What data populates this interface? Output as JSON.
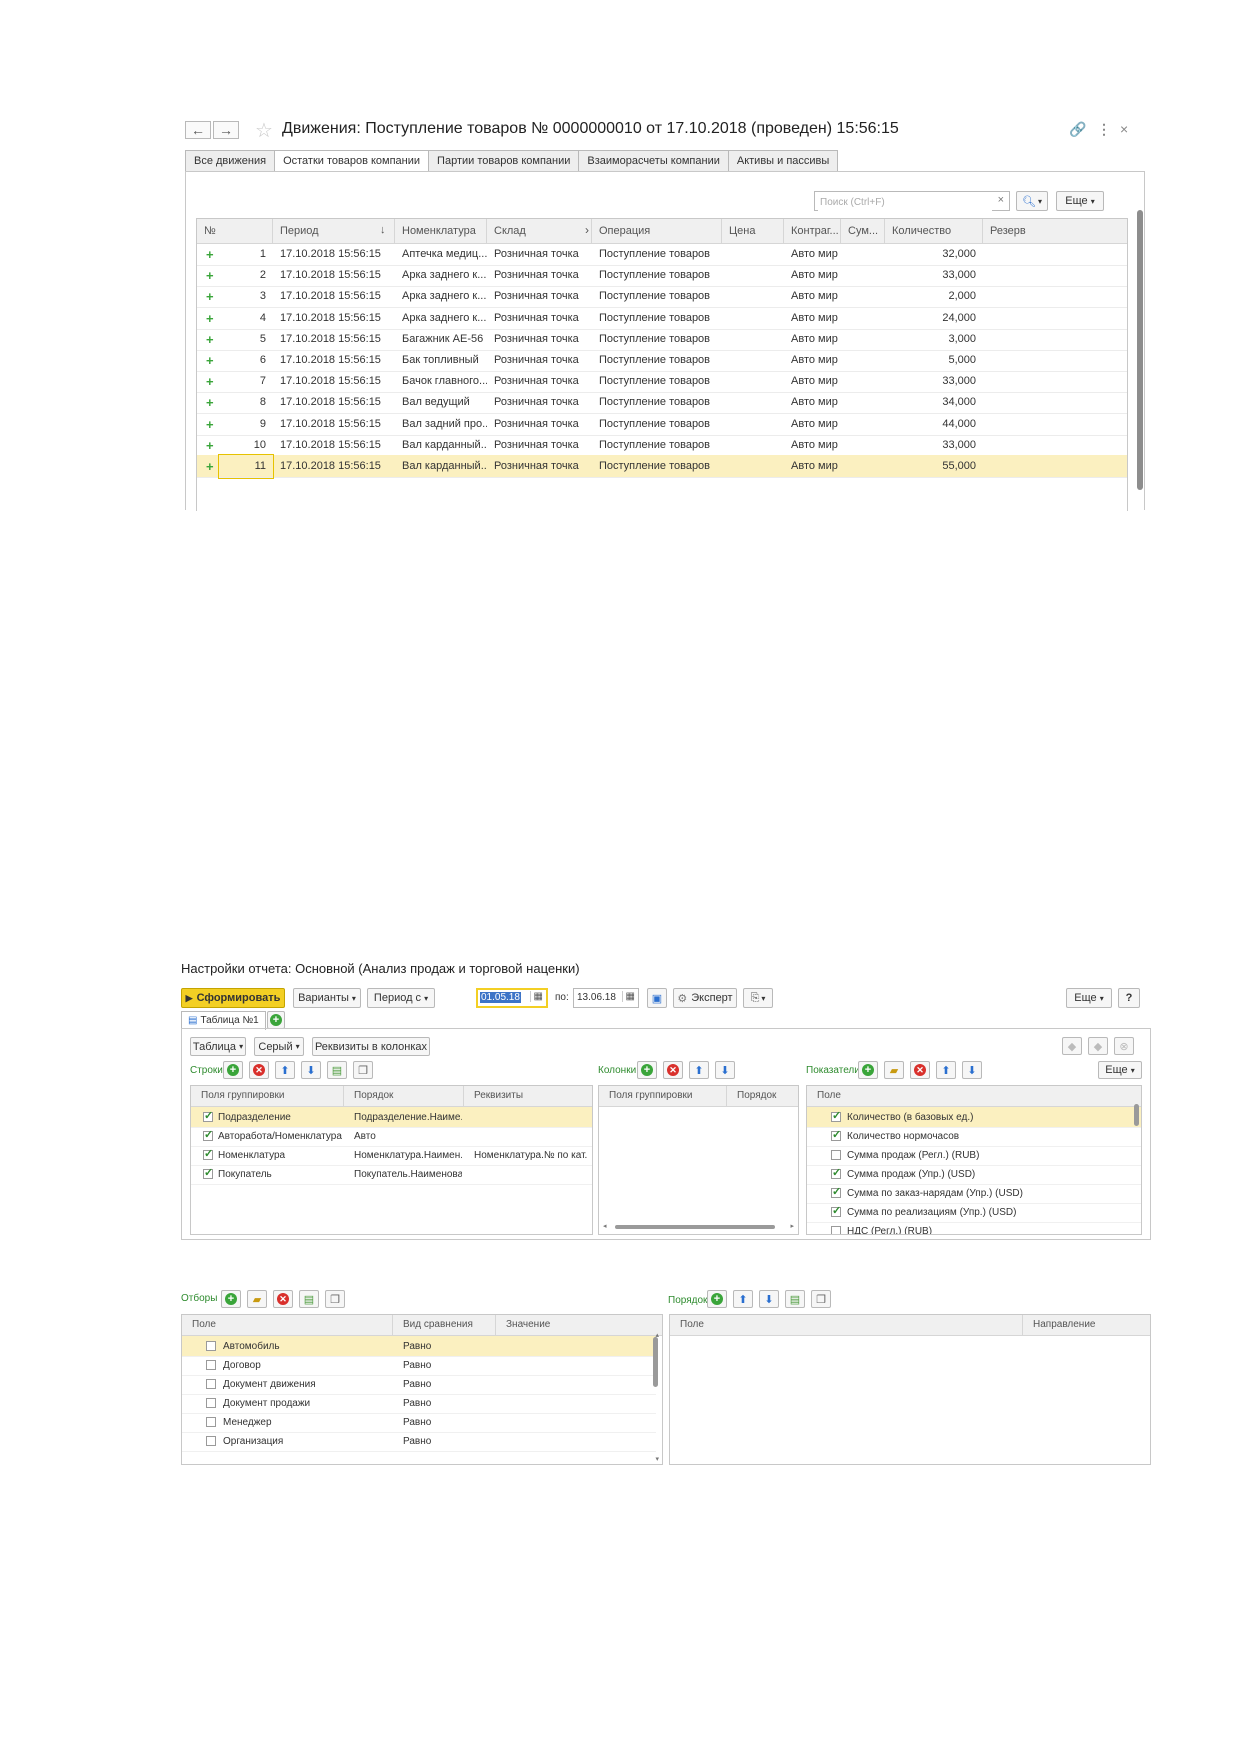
{
  "doc_window": {
    "title": "Движения: Поступление товаров № 0000000010  от 17.10.2018 (проведен) 15:56:15",
    "tabs": [
      "Все движения",
      "Остатки товаров компании",
      "Партии товаров компании",
      "Взаиморасчеты компании",
      "Активы и пассивы"
    ],
    "active_tab": 1,
    "search_placeholder": "Поиск (Ctrl+F)",
    "more_label": "Еще",
    "columns": [
      "№",
      "Период",
      "Номенклатура",
      "Склад",
      "Операция",
      "Цена",
      "Контраг...",
      "Сум...",
      "Количество",
      "Резерв"
    ],
    "rows": [
      {
        "n": "1",
        "period": "17.10.2018 15:56:15",
        "item": "Аптечка медиц...",
        "warehouse": "Розничная точка",
        "op": "Поступление товаров",
        "partner": "Авто мир",
        "qty": "32,000"
      },
      {
        "n": "2",
        "period": "17.10.2018 15:56:15",
        "item": "Арка заднего к...",
        "warehouse": "Розничная точка",
        "op": "Поступление товаров",
        "partner": "Авто мир",
        "qty": "33,000"
      },
      {
        "n": "3",
        "period": "17.10.2018 15:56:15",
        "item": "Арка заднего к...",
        "warehouse": "Розничная точка",
        "op": "Поступление товаров",
        "partner": "Авто мир",
        "qty": "2,000"
      },
      {
        "n": "4",
        "period": "17.10.2018 15:56:15",
        "item": "Арка заднего к...",
        "warehouse": "Розничная точка",
        "op": "Поступление товаров",
        "partner": "Авто мир",
        "qty": "24,000"
      },
      {
        "n": "5",
        "period": "17.10.2018 15:56:15",
        "item": "Багажник AE-56",
        "warehouse": "Розничная точка",
        "op": "Поступление товаров",
        "partner": "Авто мир",
        "qty": "3,000"
      },
      {
        "n": "6",
        "period": "17.10.2018 15:56:15",
        "item": "Бак топливный",
        "warehouse": "Розничная точка",
        "op": "Поступление товаров",
        "partner": "Авто мир",
        "qty": "5,000"
      },
      {
        "n": "7",
        "period": "17.10.2018 15:56:15",
        "item": "Бачок главного...",
        "warehouse": "Розничная точка",
        "op": "Поступление товаров",
        "partner": "Авто мир",
        "qty": "33,000"
      },
      {
        "n": "8",
        "period": "17.10.2018 15:56:15",
        "item": "Вал ведущий",
        "warehouse": "Розничная точка",
        "op": "Поступление товаров",
        "partner": "Авто мир",
        "qty": "34,000"
      },
      {
        "n": "9",
        "period": "17.10.2018 15:56:15",
        "item": "Вал задний про...",
        "warehouse": "Розничная точка",
        "op": "Поступление товаров",
        "partner": "Авто мир",
        "qty": "44,000"
      },
      {
        "n": "10",
        "period": "17.10.2018 15:56:15",
        "item": "Вал карданный...",
        "warehouse": "Розничная точка",
        "op": "Поступление товаров",
        "partner": "Авто мир",
        "qty": "33,000"
      },
      {
        "n": "11",
        "period": "17.10.2018 15:56:15",
        "item": "Вал карданный...",
        "warehouse": "Розничная точка",
        "op": "Поступление товаров",
        "partner": "Авто мир",
        "qty": "55,000"
      }
    ],
    "selected_row": 10
  },
  "report_settings": {
    "title": "Настройки отчета: Основной (Анализ продаж и торговой наценки)",
    "generate_label": "Сформировать",
    "variants_label": "Варианты",
    "period_label": "Период с",
    "date_from": "01.05.18",
    "to_label": "по:",
    "date_to": "13.06.18",
    "expert_label": "Эксперт",
    "more_label": "Еще",
    "help_label": "?",
    "table_tab": "Таблица №1",
    "table_btn": "Таблица",
    "gray_btn": "Серый",
    "props_btn": "Реквизиты в колонках",
    "rows_label": "Строки",
    "columns_label": "Колонки",
    "indicators_label": "Показатели",
    "rows_table": {
      "headers": [
        "Поля группировки",
        "Порядок",
        "Реквизиты"
      ],
      "items": [
        {
          "field": "Подразделение",
          "order": "Подразделение.Наиме...",
          "props": "",
          "checked": true
        },
        {
          "field": "Авторабота/Номенклатура",
          "order": "Авто",
          "props": "",
          "checked": true
        },
        {
          "field": "Номенклатура",
          "order": "Номенклатура.Наимен...",
          "props": "Номенклатура.№ по кат.",
          "checked": true
        },
        {
          "field": "Покупатель",
          "order": "Покупатель.Наименова...",
          "props": "",
          "checked": true
        }
      ]
    },
    "columns_table": {
      "headers": [
        "Поля группировки",
        "Порядок"
      ]
    },
    "indicators_table": {
      "header": "Поле",
      "items": [
        {
          "label": "Количество (в базовых ед.)",
          "checked": true
        },
        {
          "label": "Количество нормочасов",
          "checked": true
        },
        {
          "label": "Сумма продаж (Регл.) (RUB)",
          "checked": false
        },
        {
          "label": "Сумма продаж (Упр.) (USD)",
          "checked": true
        },
        {
          "label": "Сумма по заказ-нарядам (Упр.) (USD)",
          "checked": true
        },
        {
          "label": "Сумма по реализациям (Упр.) (USD)",
          "checked": true
        },
        {
          "label": "НДС (Регл.) (RUB)",
          "checked": false
        }
      ]
    },
    "filters_label": "Отборы",
    "filters_table": {
      "headers": [
        "Поле",
        "Вид сравнения",
        "Значение"
      ],
      "items": [
        {
          "field": "Автомобиль",
          "cmp": "Равно"
        },
        {
          "field": "Договор",
          "cmp": "Равно"
        },
        {
          "field": "Документ движения",
          "cmp": "Равно"
        },
        {
          "field": "Документ продажи",
          "cmp": "Равно"
        },
        {
          "field": "Менеджер",
          "cmp": "Равно"
        },
        {
          "field": "Организация",
          "cmp": "Равно"
        }
      ]
    },
    "order_label": "Порядок",
    "order_table": {
      "headers": [
        "Поле",
        "Направление"
      ]
    }
  },
  "colors": {
    "accent_yellow": "#f3cf24",
    "selection": "#fbf0c0",
    "green": "#3aa53a"
  }
}
